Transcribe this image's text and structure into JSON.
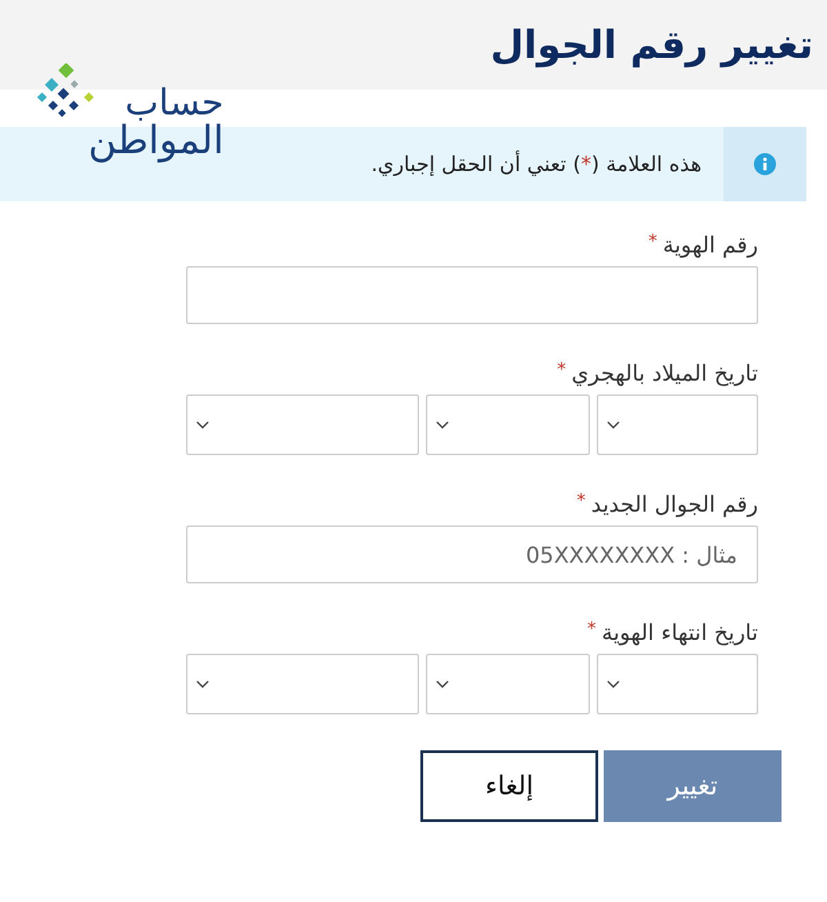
{
  "header": {
    "title": "تغيير رقم الجوال"
  },
  "logo": {
    "line_1": "حساب",
    "line_2": "المواطن"
  },
  "notice": {
    "text_before": "هذه العلامة (",
    "mark": "*",
    "text_after": ") تعني أن الحقل إجباري."
  },
  "fields": [
    {
      "kind": "text",
      "label": "رقم الهوية",
      "required_mark": "*"
    },
    {
      "kind": "date",
      "label": "تاريخ الميلاد بالهجري",
      "required_mark": "*"
    },
    {
      "kind": "text",
      "label": "رقم الجوال الجديد",
      "required_mark": "*",
      "placeholder": "مثال : 05XXXXXXXX"
    },
    {
      "kind": "date",
      "label": "تاريخ انتهاء الهوية",
      "required_mark": "*"
    }
  ],
  "buttons": [
    {
      "label": "تغيير",
      "kind": "primary"
    },
    {
      "label": "إلغاء",
      "kind": "secondary"
    }
  ]
}
